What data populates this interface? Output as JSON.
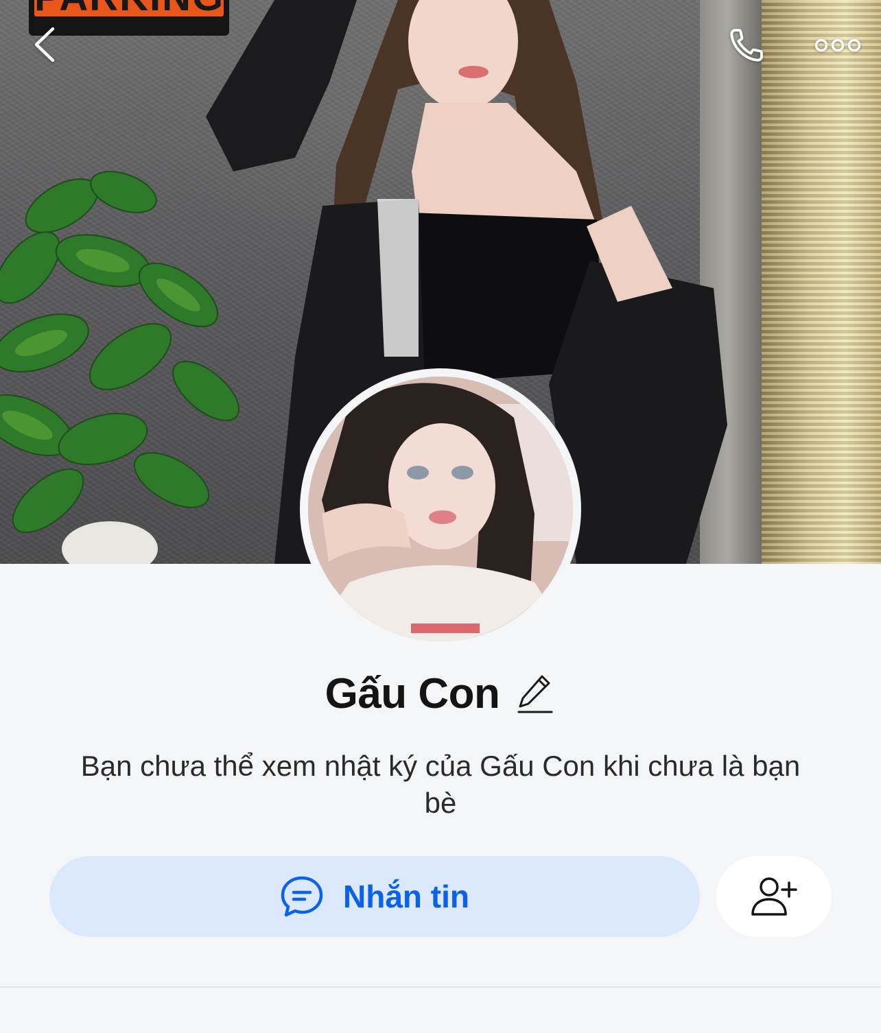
{
  "cover": {
    "sign_text": "PARKING"
  },
  "topbar": {
    "back_icon": "chevron-left-icon",
    "call_icon": "phone-icon",
    "more_icon": "more-horizontal-icon"
  },
  "profile": {
    "name": "Gấu Con",
    "edit_icon": "pencil-icon",
    "privacy_note": "Bạn chưa thể xem nhật ký của Gấu Con khi chưa là bạn bè"
  },
  "actions": {
    "message_label": "Nhắn tin",
    "message_icon": "chat-bubble-icon",
    "add_friend_icon": "add-friend-icon"
  },
  "colors": {
    "accent": "#0a62e8",
    "message_button_bg": "#dbe8fd",
    "page_bg": "#f4f5f7",
    "text_primary": "#141414"
  }
}
